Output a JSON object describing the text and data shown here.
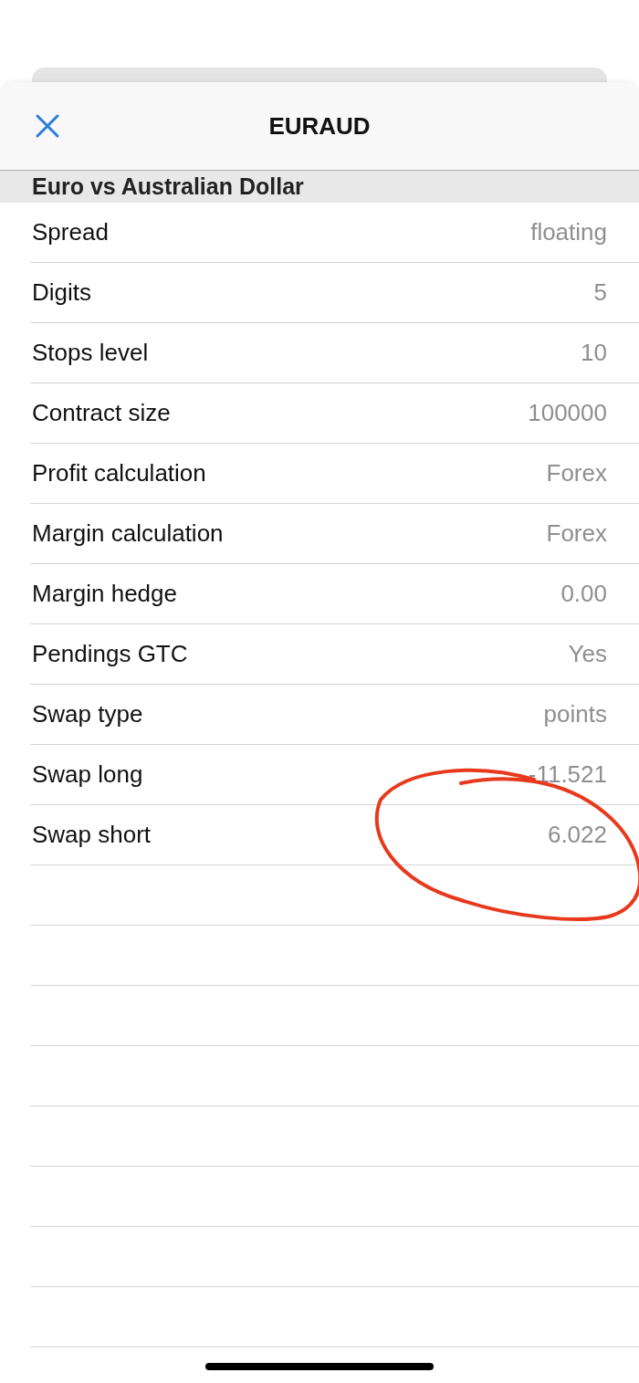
{
  "header": {
    "title": "EURAUD"
  },
  "section": {
    "title": "Euro vs Australian Dollar"
  },
  "rows": [
    {
      "label": "Spread",
      "value": "floating"
    },
    {
      "label": "Digits",
      "value": "5"
    },
    {
      "label": "Stops level",
      "value": "10"
    },
    {
      "label": "Contract size",
      "value": "100000"
    },
    {
      "label": "Profit calculation",
      "value": "Forex"
    },
    {
      "label": "Margin calculation",
      "value": "Forex"
    },
    {
      "label": "Margin hedge",
      "value": "0.00"
    },
    {
      "label": "Pendings GTC",
      "value": "Yes"
    },
    {
      "label": "Swap type",
      "value": "points"
    },
    {
      "label": "Swap long",
      "value": "-11.521"
    },
    {
      "label": "Swap short",
      "value": "6.022"
    }
  ],
  "annotation": {
    "kind": "freehand-circle"
  }
}
